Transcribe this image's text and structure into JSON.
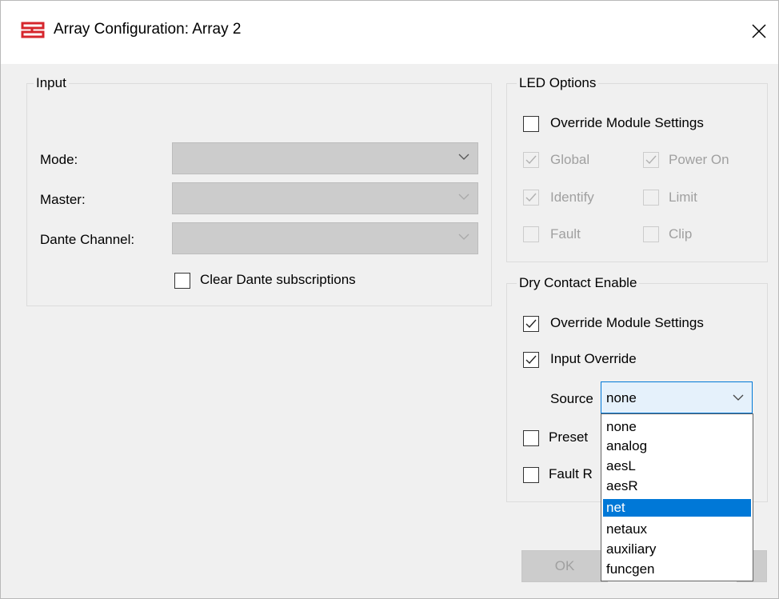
{
  "window": {
    "title": "Array Configuration: Array 2",
    "close_icon": "close-icon",
    "app_icon": "array-app-icon"
  },
  "input_group": {
    "title": "Input",
    "mode_label": "Mode:",
    "master_label": "Master:",
    "dante_channel_label": "Dante Channel:",
    "mode_value": "",
    "master_value": "",
    "dante_channel_value": "",
    "clear_dante_label": "Clear Dante subscriptions",
    "clear_dante_checked": false
  },
  "led_options": {
    "title": "LED Options",
    "override_label": "Override Module Settings",
    "override_checked": false,
    "items": [
      {
        "label": "Global",
        "checked": true,
        "enabled": false
      },
      {
        "label": "Power On",
        "checked": true,
        "enabled": false
      },
      {
        "label": "Identify",
        "checked": true,
        "enabled": false
      },
      {
        "label": "Limit",
        "checked": false,
        "enabled": false
      },
      {
        "label": "Fault",
        "checked": false,
        "enabled": false
      },
      {
        "label": "Clip",
        "checked": false,
        "enabled": false
      }
    ]
  },
  "dry_contact": {
    "title": "Dry Contact Enable",
    "override_label": "Override Module Settings",
    "override_checked": true,
    "input_override_label": "Input Override",
    "input_override_checked": true,
    "source_label": "Source",
    "source_value": "none",
    "preset_label": "Preset",
    "fault_label": "Fault R"
  },
  "source_dropdown": {
    "options": [
      "none",
      "analog",
      "aesL",
      "aesR",
      "net",
      "netaux",
      "auxiliary",
      "funcgen"
    ],
    "highlighted": "net"
  },
  "buttons": {
    "ok_label": "OK"
  },
  "colors": {
    "accent": "#0078d7",
    "title_icon": "#d6262c",
    "disabled_fill": "#cccccc"
  }
}
